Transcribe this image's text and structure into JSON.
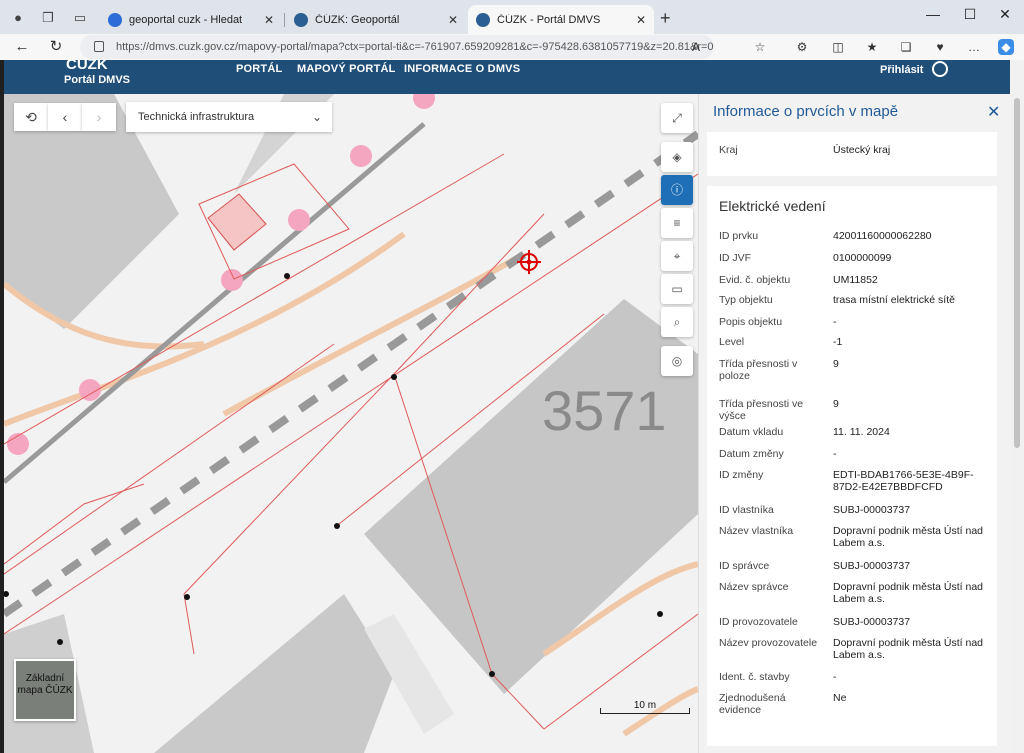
{
  "browser": {
    "tabs": [
      {
        "title": "geoportal cuzk - Hledat",
        "favicon_color": "#2b6cd8"
      },
      {
        "title": "ČÚZK: Geoportál",
        "favicon_color": "#2b5f93"
      },
      {
        "title": "ČÚZK - Portál DMVS",
        "favicon_color": "#2b5f93"
      }
    ],
    "url": "https://dmvs.cuzk.gov.cz/mapovy-portal/mapa?ctx=portal-ti&c=-761907.659209281&c=-975428.6381057719&z=20.81&r=0"
  },
  "header": {
    "logo_text": "ČÚZK",
    "portal_title": "Portál DMVS",
    "nav": [
      "PORTÁL",
      "MAPOVÝ PORTÁL",
      "INFORMACE O DMVS"
    ],
    "login": "Přihlásit"
  },
  "map": {
    "layer_select": "Technická infrastruktura",
    "basemap_label": "Základní mapa ČÚZK",
    "scale_label": "10 m",
    "building_number": "3571"
  },
  "panel": {
    "title": "Informace o prvcích v mapě",
    "region_label": "Kraj",
    "region_value": "Ústecký kraj",
    "section_title": "Elektrické vedení",
    "rows": [
      {
        "label": "ID prvku",
        "value": "42001160000062280"
      },
      {
        "label": "ID JVF",
        "value": "0100000099"
      },
      {
        "label": "Evid. č. objektu",
        "value": "UM11852"
      },
      {
        "label": "Typ objektu",
        "value": "trasa místní elektrické sítě"
      },
      {
        "label": "Popis objektu",
        "value": "-"
      },
      {
        "label": "Level",
        "value": "-1"
      },
      {
        "label": "Třída přesnosti v poloze",
        "value": "9"
      },
      {
        "label": "Třída přesnosti ve výšce",
        "value": "9"
      },
      {
        "label": "Datum vkladu",
        "value": "11. 11. 2024"
      },
      {
        "label": "Datum změny",
        "value": "-"
      },
      {
        "label": "ID změny",
        "value": "EDTI-BDAB1766-5E3E-4B9F-87D2-E42E7BBDFCFD"
      },
      {
        "label": "ID vlastníka",
        "value": "SUBJ-00003737"
      },
      {
        "label": "Název vlastníka",
        "value": "Dopravní podnik města Ústí nad Labem a.s."
      },
      {
        "label": "ID správce",
        "value": "SUBJ-00003737"
      },
      {
        "label": "Název správce",
        "value": "Dopravní podnik města Ústí nad Labem a.s."
      },
      {
        "label": "ID provozovatele",
        "value": "SUBJ-00003737"
      },
      {
        "label": "Název provozovatele",
        "value": "Dopravní podnik města Ústí nad Labem a.s."
      },
      {
        "label": "Ident. č. stavby",
        "value": "-"
      },
      {
        "label": "Zjednodušená evidence",
        "value": "Ne"
      }
    ]
  },
  "colors": {
    "header_bg": "#1f4e79",
    "accent": "#1f6fb6",
    "network_line": "#e05a5a",
    "contour": "#f0c8a8",
    "building": "#c8c8c8"
  }
}
